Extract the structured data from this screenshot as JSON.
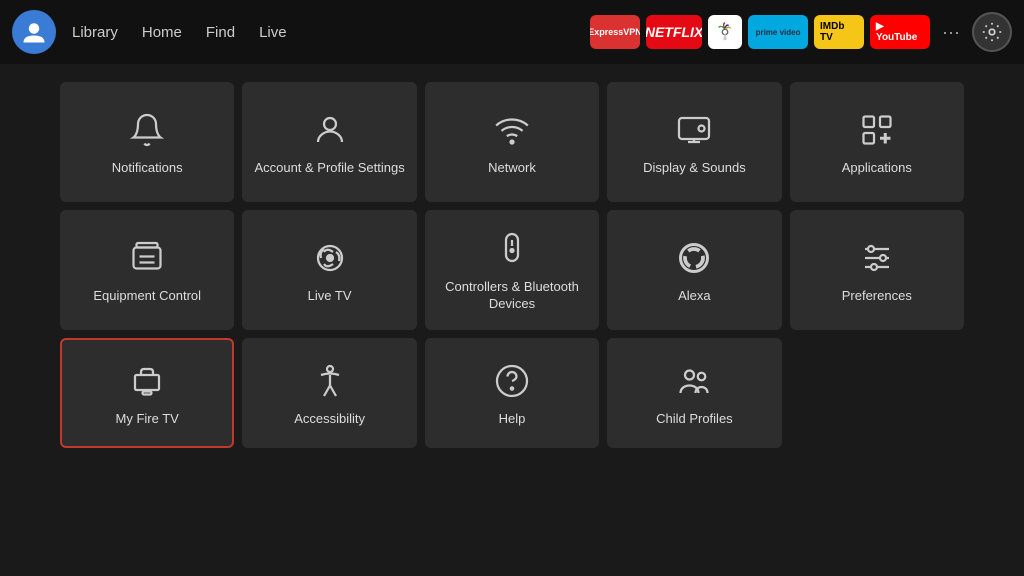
{
  "nav": {
    "links": [
      "Library",
      "Home",
      "Find",
      "Live"
    ],
    "apps": [
      {
        "name": "ExpressVPN",
        "class": "expressvpn",
        "label": "ExpressVPN"
      },
      {
        "name": "Netflix",
        "class": "netflix",
        "label": "NETFLIX"
      },
      {
        "name": "Peacock",
        "class": "peacock",
        "label": "🦚"
      },
      {
        "name": "Prime Video",
        "class": "primevideo",
        "label": "prime video"
      },
      {
        "name": "IMDb TV",
        "class": "imdbtv",
        "label": "IMDb TV"
      },
      {
        "name": "YouTube",
        "class": "youtube",
        "label": "▶ YouTube"
      }
    ],
    "more": "···",
    "settings": "⚙"
  },
  "tiles": [
    {
      "id": "notifications",
      "label": "Notifications",
      "icon": "bell"
    },
    {
      "id": "account",
      "label": "Account & Profile Settings",
      "icon": "user"
    },
    {
      "id": "network",
      "label": "Network",
      "icon": "wifi"
    },
    {
      "id": "display-sounds",
      "label": "Display & Sounds",
      "icon": "display"
    },
    {
      "id": "applications",
      "label": "Applications",
      "icon": "apps"
    },
    {
      "id": "equipment-control",
      "label": "Equipment Control",
      "icon": "tv"
    },
    {
      "id": "live-tv",
      "label": "Live TV",
      "icon": "antenna"
    },
    {
      "id": "controllers",
      "label": "Controllers & Bluetooth Devices",
      "icon": "remote"
    },
    {
      "id": "alexa",
      "label": "Alexa",
      "icon": "alexa"
    },
    {
      "id": "preferences",
      "label": "Preferences",
      "icon": "sliders"
    },
    {
      "id": "my-fire-tv",
      "label": "My Fire TV",
      "icon": "firetv",
      "selected": true
    },
    {
      "id": "accessibility",
      "label": "Accessibility",
      "icon": "accessibility"
    },
    {
      "id": "help",
      "label": "Help",
      "icon": "help"
    },
    {
      "id": "child-profiles",
      "label": "Child Profiles",
      "icon": "child-profiles"
    }
  ]
}
